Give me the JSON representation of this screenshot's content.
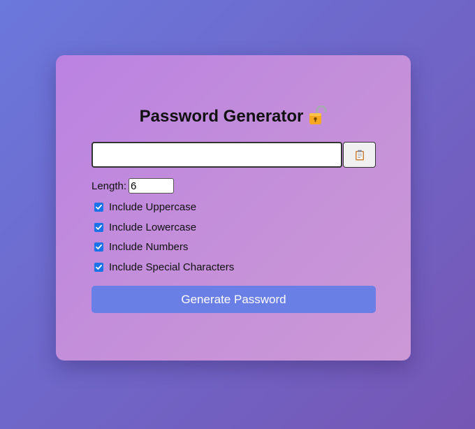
{
  "app": {
    "title": "Password Generator",
    "title_icon": "unlocked-padlock-icon"
  },
  "password": {
    "value": "",
    "placeholder": ""
  },
  "copy_button": {
    "icon": "clipboard-icon"
  },
  "length": {
    "label": "Length:",
    "value": "6"
  },
  "options": [
    {
      "label": "Include Uppercase",
      "checked": true
    },
    {
      "label": "Include Lowercase",
      "checked": true
    },
    {
      "label": "Include Numbers",
      "checked": true
    },
    {
      "label": "Include Special Characters",
      "checked": true
    }
  ],
  "generate_button": {
    "label": "Generate Password"
  },
  "colors": {
    "background_start": "#6b78dc",
    "background_end": "#7656b4",
    "card": "#c590d9",
    "accent_button": "#6a7fe6",
    "checkbox": "#1a73e8"
  }
}
